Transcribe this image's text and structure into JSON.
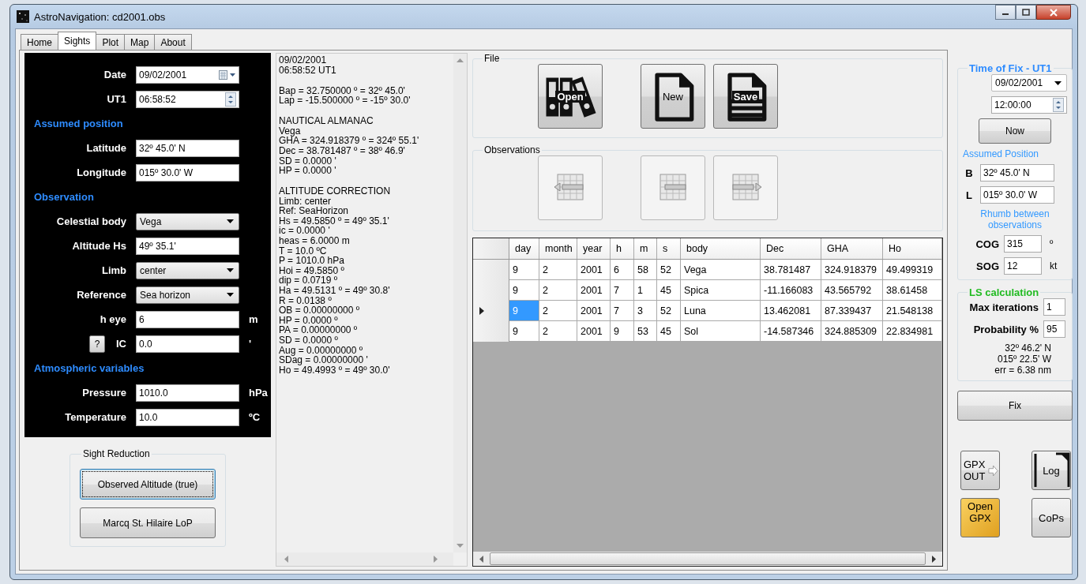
{
  "window": {
    "title": "AstroNavigation: cd2001.obs"
  },
  "tabs": [
    {
      "label": "Home",
      "selected": false
    },
    {
      "label": "Sights",
      "selected": true
    },
    {
      "label": "Plot",
      "selected": false
    },
    {
      "label": "Map",
      "selected": false
    },
    {
      "label": "About",
      "selected": false
    }
  ],
  "sight_form": [
    {
      "kind": "date",
      "label": "Date",
      "value": "09/02/2001"
    },
    {
      "kind": "time",
      "label": "UT1",
      "value": "06:58:52"
    },
    {
      "kind": "section",
      "label": "Assumed position"
    },
    {
      "kind": "input",
      "label": "Latitude",
      "value": "32º 45.0' N"
    },
    {
      "kind": "input",
      "label": "Longitude",
      "value": "015º 30.0' W"
    },
    {
      "kind": "section",
      "label": "Observation"
    },
    {
      "kind": "select",
      "label": "Celestial body",
      "value": "Vega"
    },
    {
      "kind": "input",
      "label": "Altitude Hs",
      "value": "49º 35.1'"
    },
    {
      "kind": "select",
      "label": "Limb",
      "value": "center"
    },
    {
      "kind": "select",
      "label": "Reference",
      "value": "Sea horizon"
    },
    {
      "kind": "input",
      "label": "h eye",
      "value": "6",
      "unit": "m"
    },
    {
      "kind": "input",
      "label": "IC",
      "value": "0.0",
      "unit": "'",
      "help": "?"
    },
    {
      "kind": "section",
      "label": "Atmospheric variables"
    },
    {
      "kind": "input",
      "label": "Pressure",
      "value": "1010.0",
      "unit": "hPa"
    },
    {
      "kind": "input",
      "label": "Temperature",
      "value": "10.0",
      "unit": "ºC"
    }
  ],
  "sight_reduction": {
    "title": "Sight Reduction",
    "buttons": [
      {
        "label": "Observed Altitude (true)",
        "focused": true
      },
      {
        "label": "Marcq St. Hilaire LoP",
        "focused": false
      }
    ]
  },
  "output_paragraphs": [
    [
      "09/02/2001",
      "06:58:52 UT1"
    ],
    [
      "Bap = 32.750000 º =  32º 45.0'",
      "Lap = -15.500000 º = -15º 30.0'"
    ],
    [
      "NAUTICAL ALMANAC",
      "Vega",
      "GHA = 324.918379 º = 324º 55.1'",
      "Dec = 38.781487 º =  38º 46.9'",
      "SD = 0.0000 '",
      "HP = 0.0000 '"
    ],
    [
      "ALTITUDE CORRECTION",
      "Limb: center",
      "Ref: SeaHorizon",
      "Hs = 49.5850 º =  49º 35.1'",
      "ic = 0.0000 '",
      "heas = 6.0000 m",
      "T = 10.0 ºC",
      "P = 1010.0 hPa",
      "Hoi = 49.5850 º",
      "dip = 0.0719 º",
      "Ha = 49.5131 º =  49º 30.8'",
      "R = 0.0138 º",
      "OB = 0.00000000 º",
      "HP = 0.0000 º",
      "PA = 0.00000000 º",
      "SD = 0.0000 º",
      "Aug = 0.00000000 º",
      "SDag = 0.00000000 '",
      "Ho = 49.4993 º =  49º 30.0'"
    ]
  ],
  "file_group": {
    "title": "File",
    "buttons": [
      {
        "label": "Open",
        "kind": "binders"
      },
      {
        "label": "New",
        "kind": "page"
      },
      {
        "label": "Save",
        "kind": "lined-page"
      }
    ]
  },
  "observations_group": {
    "title": "Observations",
    "buttons": [
      {
        "kind": "insert",
        "disabled": true
      },
      {
        "kind": "grid",
        "disabled": true
      },
      {
        "kind": "append",
        "disabled": true
      }
    ]
  },
  "table": {
    "columns": [
      "day",
      "month",
      "year",
      "h",
      "m",
      "s",
      "body",
      "Dec",
      "GHA",
      "Ho"
    ],
    "rows": [
      {
        "selected": false,
        "cells": [
          "9",
          "2",
          "2001",
          "6",
          "58",
          "52",
          "Vega",
          "38.781487",
          "324.918379",
          "49.499319"
        ]
      },
      {
        "selected": false,
        "cells": [
          "9",
          "2",
          "2001",
          "7",
          "1",
          "45",
          "Spica",
          "-11.166083",
          "43.565792",
          "38.61458"
        ]
      },
      {
        "selected": true,
        "cells": [
          "9",
          "2",
          "2001",
          "7",
          "3",
          "52",
          "Luna",
          "13.462081",
          "87.339437",
          "21.548138"
        ]
      },
      {
        "selected": false,
        "cells": [
          "9",
          "2",
          "2001",
          "9",
          "53",
          "45",
          "Sol",
          "-14.587346",
          "324.885309",
          "22.834981"
        ]
      }
    ]
  },
  "time_of_fix": {
    "title": "Time of Fix - UT1",
    "date": "09/02/2001",
    "time": "12:00:00",
    "now_button": "Now",
    "position_title": "Assumed Position",
    "position": [
      {
        "label": "B",
        "value": "32º 45.0' N"
      },
      {
        "label": "L",
        "value": "015º 30.0' W"
      }
    ],
    "rhumb_title": "Rhumb between observations",
    "rhumb": [
      {
        "label": "COG",
        "value": "315",
        "unit": "º"
      },
      {
        "label": "SOG",
        "value": "12",
        "unit": "kt"
      }
    ]
  },
  "ls_calculation": {
    "title": "LS calculation",
    "fields": [
      {
        "label": "Max iterations",
        "value": "1"
      },
      {
        "label": "Probability %",
        "value": "95"
      }
    ],
    "result": [
      "32º 46.2' N",
      "015º 22.5' W",
      "err = 6.38 nm"
    ]
  },
  "fix_button": "Fix",
  "tool_buttons": [
    {
      "label": "GPX OUT",
      "kind": "export"
    },
    {
      "label": "Log",
      "kind": "log"
    },
    {
      "label": "Open GPX",
      "kind": "open"
    },
    {
      "label": "CoPs",
      "kind": "plain"
    }
  ]
}
